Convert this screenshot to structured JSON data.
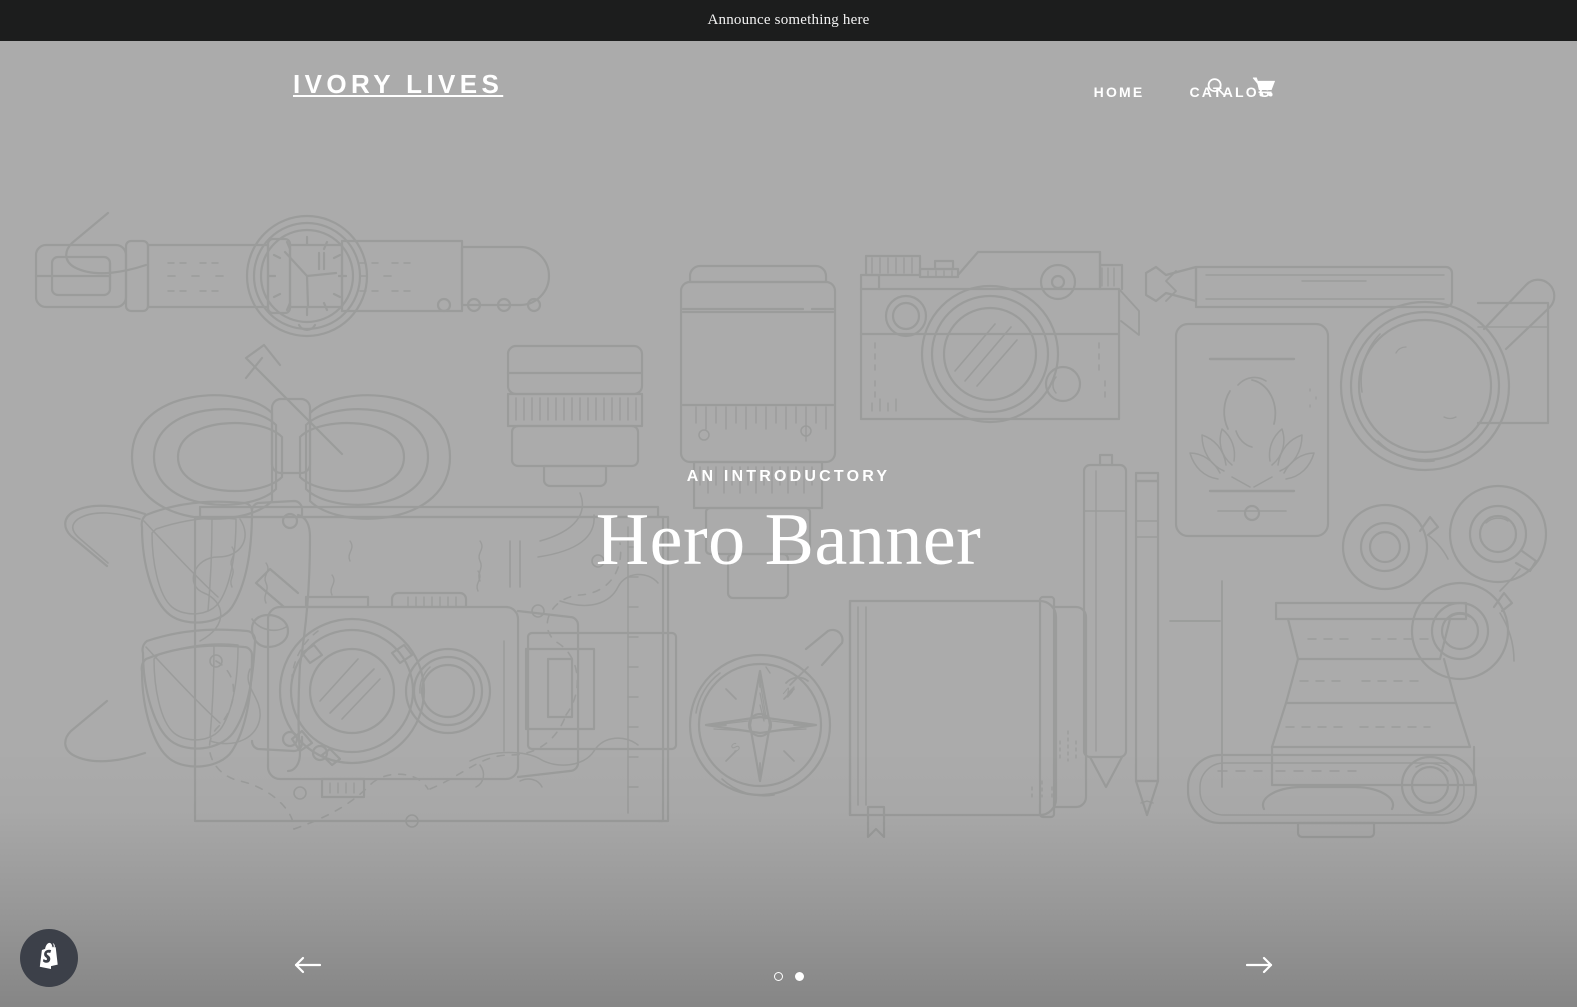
{
  "announcement": {
    "text": "Announce something here"
  },
  "header": {
    "logo": "IVORY LIVES",
    "nav": [
      {
        "label": "HOME",
        "name": "nav-link-home"
      },
      {
        "label": "CATALOG",
        "name": "nav-link-catalog"
      }
    ],
    "icons": [
      {
        "name": "search-icon",
        "label": "Search"
      },
      {
        "name": "cart-icon",
        "label": "Cart"
      }
    ]
  },
  "hero": {
    "kicker": "AN INTRODUCTORY",
    "title": "Hero Banner",
    "background_color": "#ababab",
    "art_stroke_color": "#9b9c9b",
    "illustration": "flat-lay line art of wristwatch, bow tie, camera lenses, vintage SLR camera, pencil, smartphone, magnifying glass / skillet, eyeglasses, map with action camera, compass, notebook, pen, tripod head, tape rolls and camera body"
  },
  "slider": {
    "prev_label": "Previous slide",
    "next_label": "Next slide",
    "dots": [
      {
        "active": false,
        "label": "Slide 1"
      },
      {
        "active": true,
        "label": "Slide 2"
      }
    ]
  },
  "chat_bubble": {
    "name": "shopify-logo-icon",
    "label": "Shopify",
    "color": "#3c4049"
  },
  "colors": {
    "announcement_bg": "#1c1d1d",
    "announcement_text": "#f2f2f2",
    "hero_bg": "#ababab",
    "text_on_hero": "#ffffff"
  }
}
